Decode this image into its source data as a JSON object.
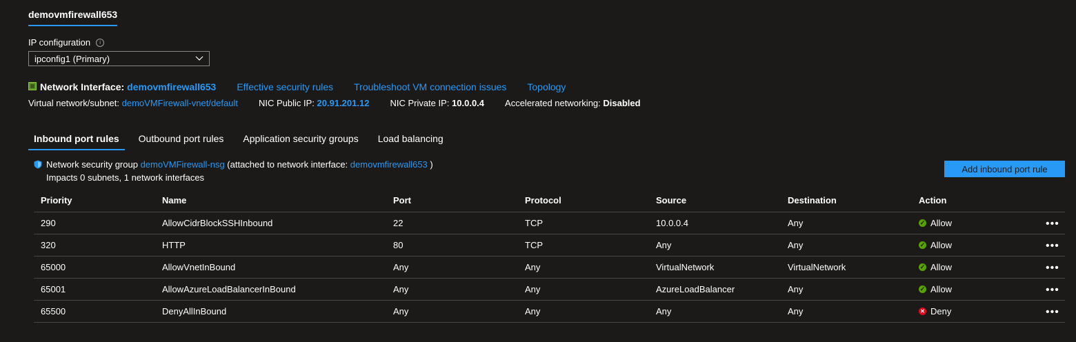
{
  "nic_tab": "demovmfirewall653",
  "ip_config": {
    "label": "IP configuration",
    "selected": "ipconfig1 (Primary)"
  },
  "nic": {
    "label": "Network Interface:",
    "name": "demovmfirewall653",
    "links": [
      "Effective security rules",
      "Troubleshoot VM connection issues",
      "Topology"
    ]
  },
  "details": {
    "vnet_label": "Virtual network/subnet:",
    "vnet_value": "demoVMFirewall-vnet/default",
    "public_ip_label": "NIC Public IP:",
    "public_ip_value": "20.91.201.12",
    "private_ip_label": "NIC Private IP:",
    "private_ip_value": "10.0.0.4",
    "accel_label": "Accelerated networking:",
    "accel_value": "Disabled"
  },
  "tabs": [
    "Inbound port rules",
    "Outbound port rules",
    "Application security groups",
    "Load balancing"
  ],
  "nsg": {
    "prefix": "Network security group",
    "name": "demoVMFirewall-nsg",
    "mid": "(attached to network interface:",
    "nic": "demovmfirewall653",
    "suffix": ")",
    "impacts": "Impacts 0 subnets, 1 network interfaces"
  },
  "add_button": "Add inbound port rule",
  "table": {
    "headers": [
      "Priority",
      "Name",
      "Port",
      "Protocol",
      "Source",
      "Destination",
      "Action"
    ],
    "rows": [
      {
        "priority": "290",
        "name": "AllowCidrBlockSSHInbound",
        "port": "22",
        "protocol": "TCP",
        "source": "10.0.0.4",
        "destination": "Any",
        "action": "Allow"
      },
      {
        "priority": "320",
        "name": "HTTP",
        "port": "80",
        "protocol": "TCP",
        "source": "Any",
        "destination": "Any",
        "action": "Allow"
      },
      {
        "priority": "65000",
        "name": "AllowVnetInBound",
        "port": "Any",
        "protocol": "Any",
        "source": "VirtualNetwork",
        "destination": "VirtualNetwork",
        "action": "Allow"
      },
      {
        "priority": "65001",
        "name": "AllowAzureLoadBalancerInBound",
        "port": "Any",
        "protocol": "Any",
        "source": "AzureLoadBalancer",
        "destination": "Any",
        "action": "Allow"
      },
      {
        "priority": "65500",
        "name": "DenyAllInBound",
        "port": "Any",
        "protocol": "Any",
        "source": "Any",
        "destination": "Any",
        "action": "Deny"
      }
    ]
  },
  "more_glyph": "•••",
  "colors": {
    "accent": "#2899f5",
    "allow": "#57a300",
    "deny": "#e00b1c",
    "background": "#1b1a19"
  },
  "icons": {
    "nic": "network-interface-icon",
    "nsg": "shield-icon",
    "allow": "check-circle-icon",
    "deny": "x-circle-icon",
    "more": "more-icon",
    "info": "info-icon",
    "dropdown": "chevron-down-icon"
  }
}
